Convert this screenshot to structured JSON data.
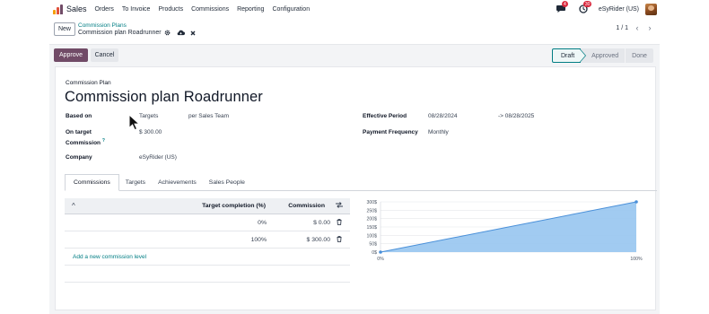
{
  "navbar": {
    "app_name": "Sales",
    "menu": [
      "Orders",
      "To Invoice",
      "Products",
      "Commissions",
      "Reporting",
      "Configuration"
    ],
    "messages_count": "4",
    "activities_count": "30",
    "company": "eSyRider (US)"
  },
  "control_panel": {
    "new_label": "New",
    "breadcrumb_parent": "Commission Plans",
    "breadcrumb_current": "Commission plan Roadrunner",
    "pager": "1 / 1"
  },
  "actions": {
    "approve": "Approve",
    "cancel": "Cancel"
  },
  "statusbar": [
    "Draft",
    "Approved",
    "Done"
  ],
  "form": {
    "small_label": "Commission Plan",
    "title": "Commission plan Roadrunner",
    "based_on_label": "Based on",
    "based_on_value": "Targets",
    "based_on_team": "per Sales Team",
    "on_target_label_1": "On target",
    "on_target_label_2": "Commission",
    "on_target_help": "?",
    "on_target_value": "$ 300.00",
    "company_label": "Company",
    "company_value": "eSyRider (US)",
    "period_label": "Effective Period",
    "period_from": "08/28/2024",
    "period_to": "-> 08/28/2025",
    "frequency_label": "Payment Frequency",
    "frequency_value": "Monthly"
  },
  "tabs": [
    "Commissions",
    "Targets",
    "Achievements",
    "Sales People"
  ],
  "levels_table": {
    "header_caret": "^",
    "col_target": "Target completion (%)",
    "col_commission": "Commission",
    "rows": [
      {
        "target": "0%",
        "commission": "$ 0.00"
      },
      {
        "target": "100%",
        "commission": "$ 300.00"
      }
    ],
    "add_line": "Add a new commission level"
  },
  "chart_data": {
    "type": "area",
    "x": [
      0,
      100
    ],
    "y": [
      0,
      300
    ],
    "x_tick_labels": [
      "0%",
      "100%"
    ],
    "y_tick_labels": [
      "0$",
      "50$",
      "100$",
      "150$",
      "200$",
      "250$",
      "300$"
    ],
    "y_ticks": [
      0,
      50,
      100,
      150,
      200,
      250,
      300
    ],
    "ylim": [
      0,
      300
    ],
    "xlim": [
      0,
      100
    ],
    "fill_color": "#9cc8f0",
    "line_color": "#4a90d9"
  },
  "colors": {
    "primary": "#714b67",
    "link": "#017e84",
    "badge": "#d9293e"
  }
}
